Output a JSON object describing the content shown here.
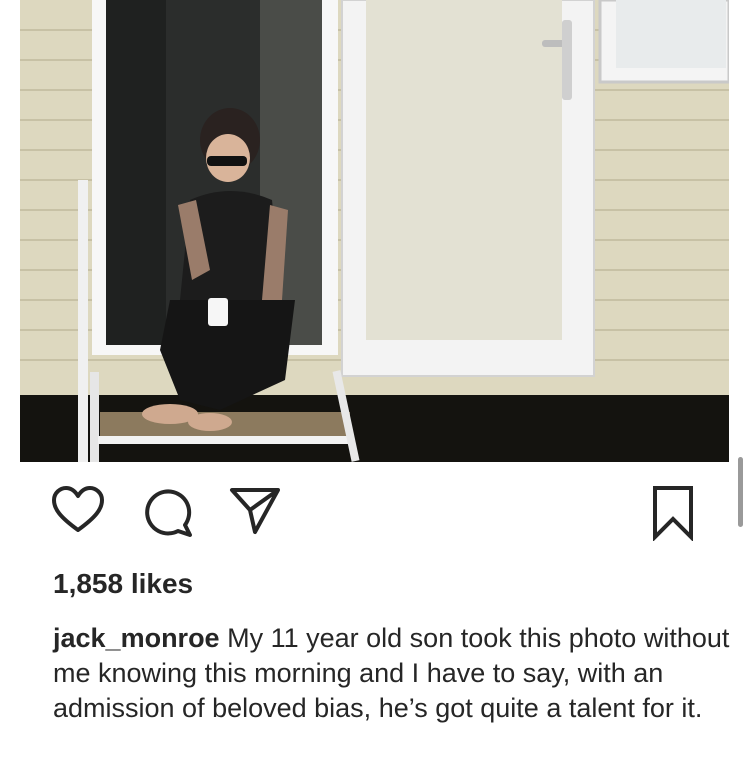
{
  "post": {
    "likes": "1,858 likes",
    "username": "jack_monroe",
    "caption": "My 11 year old son took this photo without me knowing this morning and I have to say, with an admission of beloved bias, he’s got quite a talent for it."
  },
  "actions": {
    "like_icon": "heart-outline-icon",
    "comment_icon": "speech-bubble-icon",
    "share_icon": "paper-plane-icon",
    "save_icon": "bookmark-outline-icon"
  },
  "colors": {
    "text": "#262626",
    "icon": "#262626"
  }
}
